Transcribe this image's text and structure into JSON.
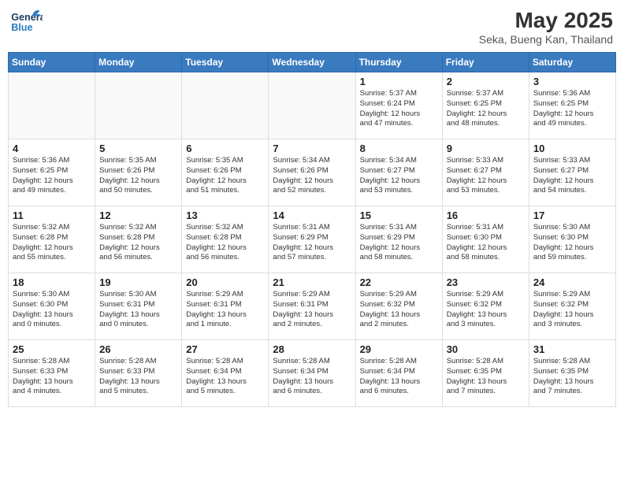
{
  "header": {
    "logo_general": "General",
    "logo_blue": "Blue",
    "month_year": "May 2025",
    "location": "Seka, Bueng Kan, Thailand"
  },
  "days_of_week": [
    "Sunday",
    "Monday",
    "Tuesday",
    "Wednesday",
    "Thursday",
    "Friday",
    "Saturday"
  ],
  "weeks": [
    [
      {
        "day": "",
        "info": ""
      },
      {
        "day": "",
        "info": ""
      },
      {
        "day": "",
        "info": ""
      },
      {
        "day": "",
        "info": ""
      },
      {
        "day": "1",
        "info": "Sunrise: 5:37 AM\nSunset: 6:24 PM\nDaylight: 12 hours\nand 47 minutes."
      },
      {
        "day": "2",
        "info": "Sunrise: 5:37 AM\nSunset: 6:25 PM\nDaylight: 12 hours\nand 48 minutes."
      },
      {
        "day": "3",
        "info": "Sunrise: 5:36 AM\nSunset: 6:25 PM\nDaylight: 12 hours\nand 49 minutes."
      }
    ],
    [
      {
        "day": "4",
        "info": "Sunrise: 5:36 AM\nSunset: 6:25 PM\nDaylight: 12 hours\nand 49 minutes."
      },
      {
        "day": "5",
        "info": "Sunrise: 5:35 AM\nSunset: 6:26 PM\nDaylight: 12 hours\nand 50 minutes."
      },
      {
        "day": "6",
        "info": "Sunrise: 5:35 AM\nSunset: 6:26 PM\nDaylight: 12 hours\nand 51 minutes."
      },
      {
        "day": "7",
        "info": "Sunrise: 5:34 AM\nSunset: 6:26 PM\nDaylight: 12 hours\nand 52 minutes."
      },
      {
        "day": "8",
        "info": "Sunrise: 5:34 AM\nSunset: 6:27 PM\nDaylight: 12 hours\nand 53 minutes."
      },
      {
        "day": "9",
        "info": "Sunrise: 5:33 AM\nSunset: 6:27 PM\nDaylight: 12 hours\nand 53 minutes."
      },
      {
        "day": "10",
        "info": "Sunrise: 5:33 AM\nSunset: 6:27 PM\nDaylight: 12 hours\nand 54 minutes."
      }
    ],
    [
      {
        "day": "11",
        "info": "Sunrise: 5:32 AM\nSunset: 6:28 PM\nDaylight: 12 hours\nand 55 minutes."
      },
      {
        "day": "12",
        "info": "Sunrise: 5:32 AM\nSunset: 6:28 PM\nDaylight: 12 hours\nand 56 minutes."
      },
      {
        "day": "13",
        "info": "Sunrise: 5:32 AM\nSunset: 6:28 PM\nDaylight: 12 hours\nand 56 minutes."
      },
      {
        "day": "14",
        "info": "Sunrise: 5:31 AM\nSunset: 6:29 PM\nDaylight: 12 hours\nand 57 minutes."
      },
      {
        "day": "15",
        "info": "Sunrise: 5:31 AM\nSunset: 6:29 PM\nDaylight: 12 hours\nand 58 minutes."
      },
      {
        "day": "16",
        "info": "Sunrise: 5:31 AM\nSunset: 6:30 PM\nDaylight: 12 hours\nand 58 minutes."
      },
      {
        "day": "17",
        "info": "Sunrise: 5:30 AM\nSunset: 6:30 PM\nDaylight: 12 hours\nand 59 minutes."
      }
    ],
    [
      {
        "day": "18",
        "info": "Sunrise: 5:30 AM\nSunset: 6:30 PM\nDaylight: 13 hours\nand 0 minutes."
      },
      {
        "day": "19",
        "info": "Sunrise: 5:30 AM\nSunset: 6:31 PM\nDaylight: 13 hours\nand 0 minutes."
      },
      {
        "day": "20",
        "info": "Sunrise: 5:29 AM\nSunset: 6:31 PM\nDaylight: 13 hours\nand 1 minute."
      },
      {
        "day": "21",
        "info": "Sunrise: 5:29 AM\nSunset: 6:31 PM\nDaylight: 13 hours\nand 2 minutes."
      },
      {
        "day": "22",
        "info": "Sunrise: 5:29 AM\nSunset: 6:32 PM\nDaylight: 13 hours\nand 2 minutes."
      },
      {
        "day": "23",
        "info": "Sunrise: 5:29 AM\nSunset: 6:32 PM\nDaylight: 13 hours\nand 3 minutes."
      },
      {
        "day": "24",
        "info": "Sunrise: 5:29 AM\nSunset: 6:32 PM\nDaylight: 13 hours\nand 3 minutes."
      }
    ],
    [
      {
        "day": "25",
        "info": "Sunrise: 5:28 AM\nSunset: 6:33 PM\nDaylight: 13 hours\nand 4 minutes."
      },
      {
        "day": "26",
        "info": "Sunrise: 5:28 AM\nSunset: 6:33 PM\nDaylight: 13 hours\nand 5 minutes."
      },
      {
        "day": "27",
        "info": "Sunrise: 5:28 AM\nSunset: 6:34 PM\nDaylight: 13 hours\nand 5 minutes."
      },
      {
        "day": "28",
        "info": "Sunrise: 5:28 AM\nSunset: 6:34 PM\nDaylight: 13 hours\nand 6 minutes."
      },
      {
        "day": "29",
        "info": "Sunrise: 5:28 AM\nSunset: 6:34 PM\nDaylight: 13 hours\nand 6 minutes."
      },
      {
        "day": "30",
        "info": "Sunrise: 5:28 AM\nSunset: 6:35 PM\nDaylight: 13 hours\nand 7 minutes."
      },
      {
        "day": "31",
        "info": "Sunrise: 5:28 AM\nSunset: 6:35 PM\nDaylight: 13 hours\nand 7 minutes."
      }
    ]
  ]
}
